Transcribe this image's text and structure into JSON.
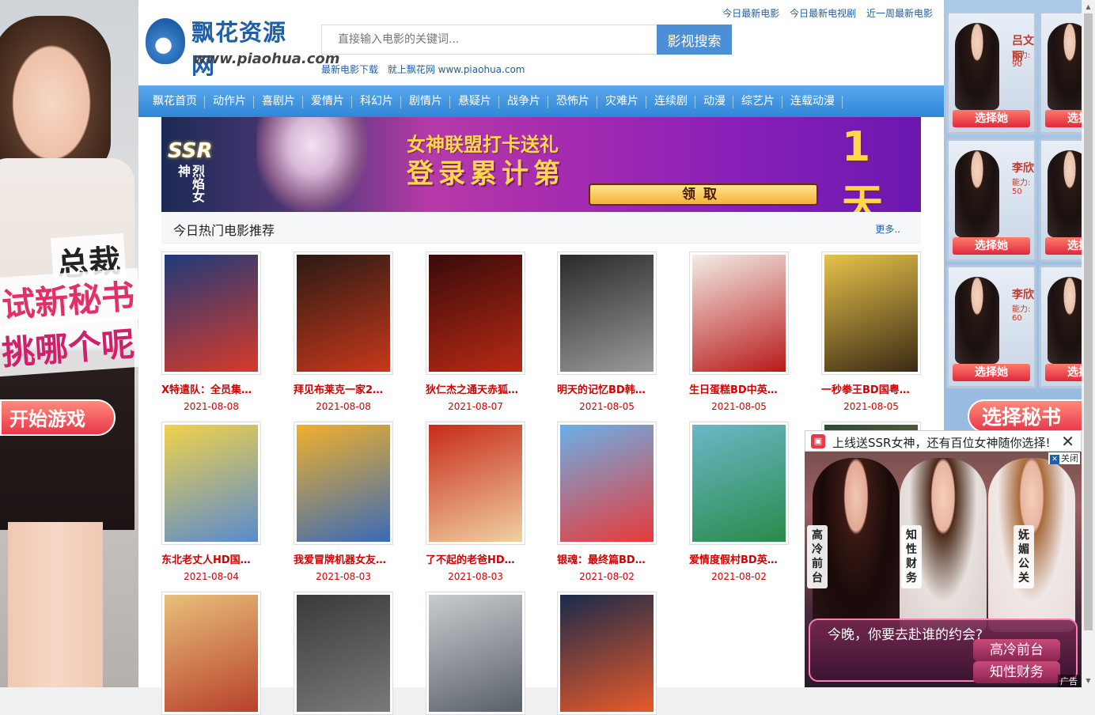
{
  "left_ad": {
    "line1": "总裁",
    "line2": "试新秘书",
    "line3": "挑哪个呢",
    "start_button": "开始游戏"
  },
  "header": {
    "logo_cn": "飘花资源网",
    "logo_en": "www.piaohua.com",
    "search_placeholder": "直接输入电影的关键词...",
    "search_button": "影视搜索",
    "sublinks": [
      "最新电影下载",
      "就上飘花网 www.piaohua.com"
    ],
    "toplinks": [
      "今日最新电影",
      "今日最新电视剧",
      "近一周最新电影"
    ]
  },
  "nav": [
    "飘花首页",
    "动作片",
    "喜剧片",
    "爱情片",
    "科幻片",
    "剧情片",
    "悬疑片",
    "战争片",
    "恐怖片",
    "灾难片",
    "连续剧",
    "动漫",
    "综艺片",
    "连载动漫"
  ],
  "banner": {
    "ssr": "SSR",
    "ssr_sub": "烈焰女神",
    "line1": "女神联盟打卡送礼",
    "line2": "登录累计第",
    "day_num": "1",
    "day_unit": "天",
    "claim": "领取"
  },
  "section": {
    "title": "今日热门电影推荐",
    "more": "更多.."
  },
  "movies": [
    {
      "title": "X特遣队：全员集…",
      "date": "2021-08-08",
      "color_a": "#1f3a7a",
      "color_b": "#d83a2a"
    },
    {
      "title": "拜见布莱克一家2…",
      "date": "2021-08-08",
      "color_a": "#2a1a14",
      "color_b": "#c8381a"
    },
    {
      "title": "狄仁杰之通天赤狐…",
      "date": "2021-08-07",
      "color_a": "#3a0a0a",
      "color_b": "#b82a14"
    },
    {
      "title": "明天的记忆BD韩…",
      "date": "2021-08-05",
      "color_a": "#2a2a2a",
      "color_b": "#9a9a9a"
    },
    {
      "title": "生日蛋糕BD中英…",
      "date": "2021-08-05",
      "color_a": "#f3ece6",
      "color_b": "#b81a1a"
    },
    {
      "title": "一秒拳王BD国粤…",
      "date": "2021-08-05",
      "color_a": "#e8c24a",
      "color_b": "#3a2a14"
    },
    {
      "title": "东北老丈人HD国…",
      "date": "2021-08-04",
      "color_a": "#f0d24a",
      "color_b": "#5a8ad0"
    },
    {
      "title": "我爱冒牌机器女友…",
      "date": "2021-08-03",
      "color_a": "#f0b02a",
      "color_b": "#3a6ab8"
    },
    {
      "title": "了不起的老爸HD…",
      "date": "2021-08-03",
      "color_a": "#c82a1a",
      "color_b": "#f0d0a0"
    },
    {
      "title": "银魂：最终篇BD…",
      "date": "2021-08-02",
      "color_a": "#6ab0e8",
      "color_b": "#e83a3a"
    },
    {
      "title": "爱情度假村BD英…",
      "date": "2021-08-02",
      "color_a": "#6ab8c8",
      "color_b": "#2a8a4a"
    },
    {
      "title": "",
      "date": "",
      "color_a": "#2a4a3a",
      "color_b": "#c88a2a"
    },
    {
      "title": "",
      "date": "",
      "color_a": "#e8c07a",
      "color_b": "#b8402a"
    },
    {
      "title": "",
      "date": "",
      "color_a": "#3a3a3a",
      "color_b": "#7a7a7a"
    },
    {
      "title": "",
      "date": "",
      "color_a": "#c8ccd0",
      "color_b": "#5a6068"
    },
    {
      "title": "",
      "date": "",
      "color_a": "#1a2a4a",
      "color_b": "#e85a2a"
    }
  ],
  "right_ad": {
    "cards": [
      {
        "name": "吕文丽",
        "power": "能力: 90",
        "pick": "选择她"
      },
      {
        "name": "",
        "power": "",
        "pick": "选择她"
      },
      {
        "name": "李欣",
        "power": "能力: 50",
        "pick": "选择她"
      },
      {
        "name": "",
        "power": "",
        "pick": "选择她"
      },
      {
        "name": "李欣",
        "power": "能力: 60",
        "pick": "选择她"
      },
      {
        "name": "",
        "power": "",
        "pick": "选择她"
      }
    ],
    "pick_secretary": "选择秘书"
  },
  "popup": {
    "message": "上线送SSR女神，还有百位女神随你选择!",
    "close_label": "关闭",
    "tags": [
      "高冷前台",
      "知性财务",
      "妩媚公关"
    ],
    "question": "今晚，你要去赴谁的约会?",
    "option1": "高冷前台",
    "option2": "知性财务",
    "ad_label": "广告"
  }
}
